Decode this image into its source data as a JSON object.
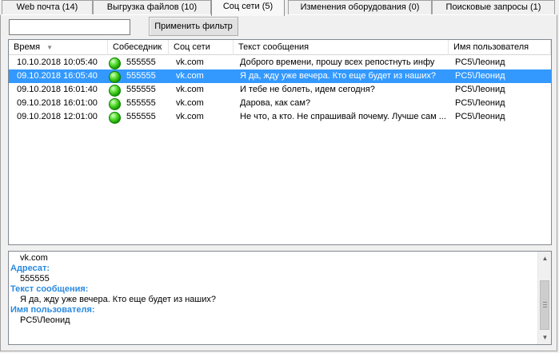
{
  "tabs": [
    {
      "label": "Web почта (14)"
    },
    {
      "label": "Выгрузка файлов (10)"
    },
    {
      "label": "Соц сети (5)"
    },
    {
      "label": "Изменения оборудования (0)"
    },
    {
      "label": "Поисковые запросы (1)"
    }
  ],
  "active_tab": "Соц сети (5)",
  "filter": {
    "value": "",
    "button_label": "Применить фильтр"
  },
  "table": {
    "columns": [
      "Время",
      "Собеседник",
      "Соц сети",
      "Текст сообщения",
      "Имя пользователя"
    ],
    "sort_column": "Время",
    "rows": [
      {
        "time": "10.10.2018 10:05:40",
        "peer": "555555",
        "network": "vk.com",
        "text": "Доброго времени, прошу всех репостнуть инфу",
        "user": "PC5\\Леонид",
        "status": "online"
      },
      {
        "time": "09.10.2018 16:05:40",
        "peer": "555555",
        "network": "vk.com",
        "text": "Я да, жду уже вечера. Кто еще будет из наших?",
        "user": "PC5\\Леонид",
        "status": "online"
      },
      {
        "time": "09.10.2018 16:01:40",
        "peer": "555555",
        "network": "vk.com",
        "text": "И тебе не болеть, идем сегодня?",
        "user": "PC5\\Леонид",
        "status": "online"
      },
      {
        "time": "09.10.2018 16:01:00",
        "peer": "555555",
        "network": "vk.com",
        "text": "Дарова, как сам?",
        "user": "PC5\\Леонид",
        "status": "online"
      },
      {
        "time": "09.10.2018 12:01:00",
        "peer": "555555",
        "network": "vk.com",
        "text": "Не что, а кто. Не спрашивай почему. Лучше сам ...",
        "user": "PC5\\Леонид",
        "status": "online"
      }
    ],
    "selected_row": 1
  },
  "details": {
    "network_value": "vk.com",
    "recipient_label": "Адресат:",
    "recipient_value": "555555",
    "text_label": "Текст сообщения:",
    "text_value": "Я да, жду уже вечера. Кто еще будет из наших?",
    "user_label": "Имя пользователя:",
    "user_value": "PC5\\Леонид"
  },
  "colors": {
    "selection": "#3399ff",
    "label_blue": "#2a8ae0",
    "status_online": "#19a300"
  }
}
